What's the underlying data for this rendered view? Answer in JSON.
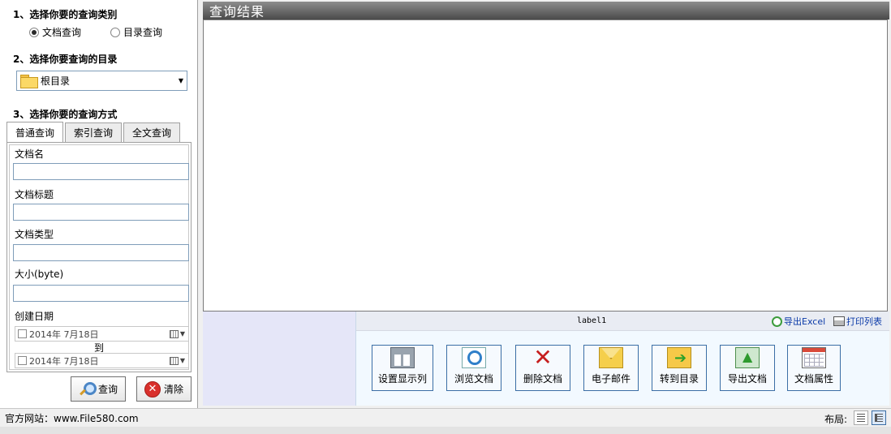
{
  "left_panel": {
    "step1_title": "1、选择你要的查询类别",
    "query_types": [
      {
        "label": "文档查询",
        "selected": true
      },
      {
        "label": "目录查询",
        "selected": false
      }
    ],
    "step2_title": "2、选择你要查询的目录",
    "directory": {
      "value": "根目录",
      "icon": "folder-icon"
    },
    "step3_title": "3、选择你要的查询方式",
    "tabs": [
      {
        "label": "普通查询",
        "active": true
      },
      {
        "label": "索引查询",
        "active": false
      },
      {
        "label": "全文查询",
        "active": false
      }
    ],
    "fields": {
      "doc_name": {
        "label": "文档名",
        "value": ""
      },
      "doc_title": {
        "label": "文档标题",
        "value": ""
      },
      "doc_type": {
        "label": "文档类型",
        "value": ""
      },
      "size": {
        "label": "大小(byte)",
        "value": ""
      }
    },
    "created_date": {
      "label": "创建日期",
      "from": "2014年  7月18日",
      "to_label": "到",
      "to": "2014年  7月18日"
    },
    "search_button": "查询",
    "clear_button": "清除"
  },
  "results": {
    "header": "查询结果",
    "label1": "label1",
    "export_excel": "导出Excel",
    "print_list": "打印列表"
  },
  "toolbar": {
    "buttons": [
      {
        "label": "设置显示列",
        "icon": "columns-icon"
      },
      {
        "label": "浏览文档",
        "icon": "browse-icon"
      },
      {
        "label": "删除文档",
        "icon": "delete-icon"
      },
      {
        "label": "电子邮件",
        "icon": "mail-icon"
      },
      {
        "label": "转到目录",
        "icon": "goto-folder-icon"
      },
      {
        "label": "导出文档",
        "icon": "export-icon"
      },
      {
        "label": "文档属性",
        "icon": "properties-icon"
      }
    ]
  },
  "statusbar": {
    "site": "官方网站：www.File580.com",
    "layout_label": "布局:"
  },
  "colors": {
    "header_dark": "#4a4a4a",
    "button_border": "#3b6ea5",
    "link": "#0b3aa8"
  }
}
